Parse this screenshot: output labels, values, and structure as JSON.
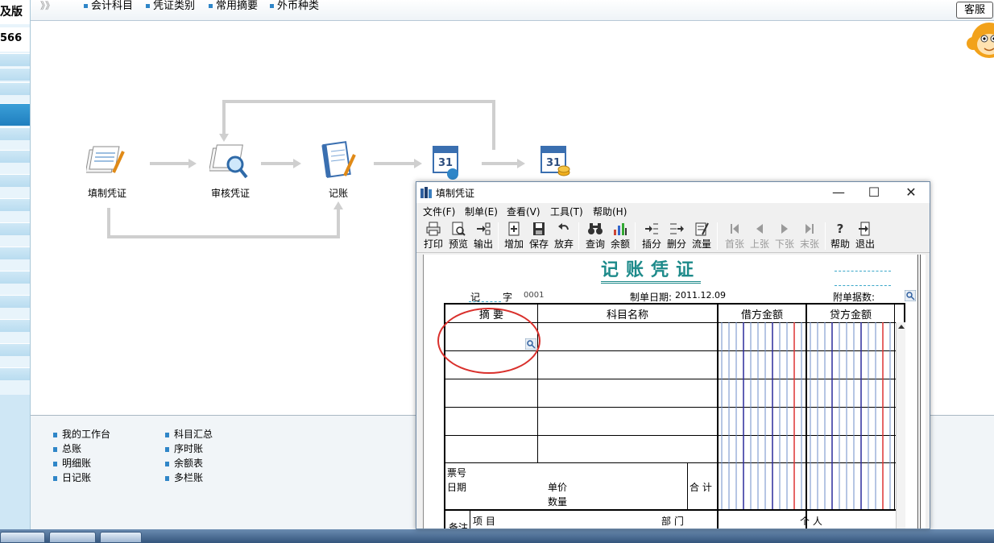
{
  "sidebar": {
    "brand": "及版",
    "code": "566"
  },
  "topbar": {
    "nav_arrows": "》》",
    "links": [
      {
        "label": "会计科目"
      },
      {
        "label": "凭证类别"
      },
      {
        "label": "常用摘要"
      },
      {
        "label": "外币种类"
      }
    ],
    "service_button": "客服"
  },
  "flow": {
    "nodes": [
      {
        "label": "填制凭证",
        "icon": "voucher-pen-icon"
      },
      {
        "label": "审核凭证",
        "icon": "magnifier-review-icon"
      },
      {
        "label": "记账",
        "icon": "ledger-pen-icon"
      },
      {
        "label": "",
        "icon": "calendar-month-end-icon"
      },
      {
        "label": "",
        "icon": "calendar-coins-icon"
      }
    ]
  },
  "bottom_links": {
    "col1": [
      "我的工作台",
      "总账",
      "明细账",
      "日记账"
    ],
    "col2": [
      "科目汇总",
      "序时账",
      "余额表",
      "多栏账"
    ]
  },
  "window": {
    "title": "填制凭证",
    "menus": [
      "文件(F)",
      "制单(E)",
      "查看(V)",
      "工具(T)",
      "帮助(H)"
    ],
    "toolbar": [
      {
        "label": "打印",
        "icon": "print-icon",
        "enabled": true
      },
      {
        "label": "预览",
        "icon": "preview-icon",
        "enabled": true
      },
      {
        "label": "输出",
        "icon": "export-icon",
        "enabled": true
      },
      {
        "label": "增加",
        "icon": "add-icon",
        "enabled": true
      },
      {
        "label": "保存",
        "icon": "save-icon",
        "enabled": true
      },
      {
        "label": "放弃",
        "icon": "undo-icon",
        "enabled": true
      },
      {
        "label": "查询",
        "icon": "binoculars-icon",
        "enabled": true
      },
      {
        "label": "余额",
        "icon": "bar-chart-icon",
        "enabled": true
      },
      {
        "label": "插分",
        "icon": "insert-row-icon",
        "enabled": true
      },
      {
        "label": "删分",
        "icon": "delete-row-icon",
        "enabled": true
      },
      {
        "label": "流量",
        "icon": "cashflow-icon",
        "enabled": true
      },
      {
        "label": "首张",
        "icon": "first-icon",
        "enabled": false
      },
      {
        "label": "上张",
        "icon": "prev-icon",
        "enabled": false
      },
      {
        "label": "下张",
        "icon": "next-icon",
        "enabled": false
      },
      {
        "label": "末张",
        "icon": "last-icon",
        "enabled": false
      },
      {
        "label": "帮助",
        "icon": "help-icon",
        "enabled": true
      },
      {
        "label": "退出",
        "icon": "exit-icon",
        "enabled": true
      }
    ]
  },
  "voucher": {
    "title": "记账凭证",
    "type_label": "记",
    "zi_label": "字",
    "number": "0001",
    "date_label": "制单日期:",
    "date": "2011.12.09",
    "attachments_label": "附单据数:",
    "columns": {
      "summary": "摘  要",
      "account": "科目名称",
      "debit": "借方金额",
      "credit": "贷方金额"
    },
    "footer": {
      "ticket_no": "票号",
      "date": "日期",
      "unit_price": "单价",
      "quantity": "数量",
      "total": "合 计",
      "remark": "备注",
      "project": "项  目",
      "department": "部  门",
      "person": "个  人"
    }
  },
  "colors": {
    "accent": "#1d8a8a",
    "highlight_circle": "#d9302c",
    "nav_bullet": "#2f86c8"
  }
}
